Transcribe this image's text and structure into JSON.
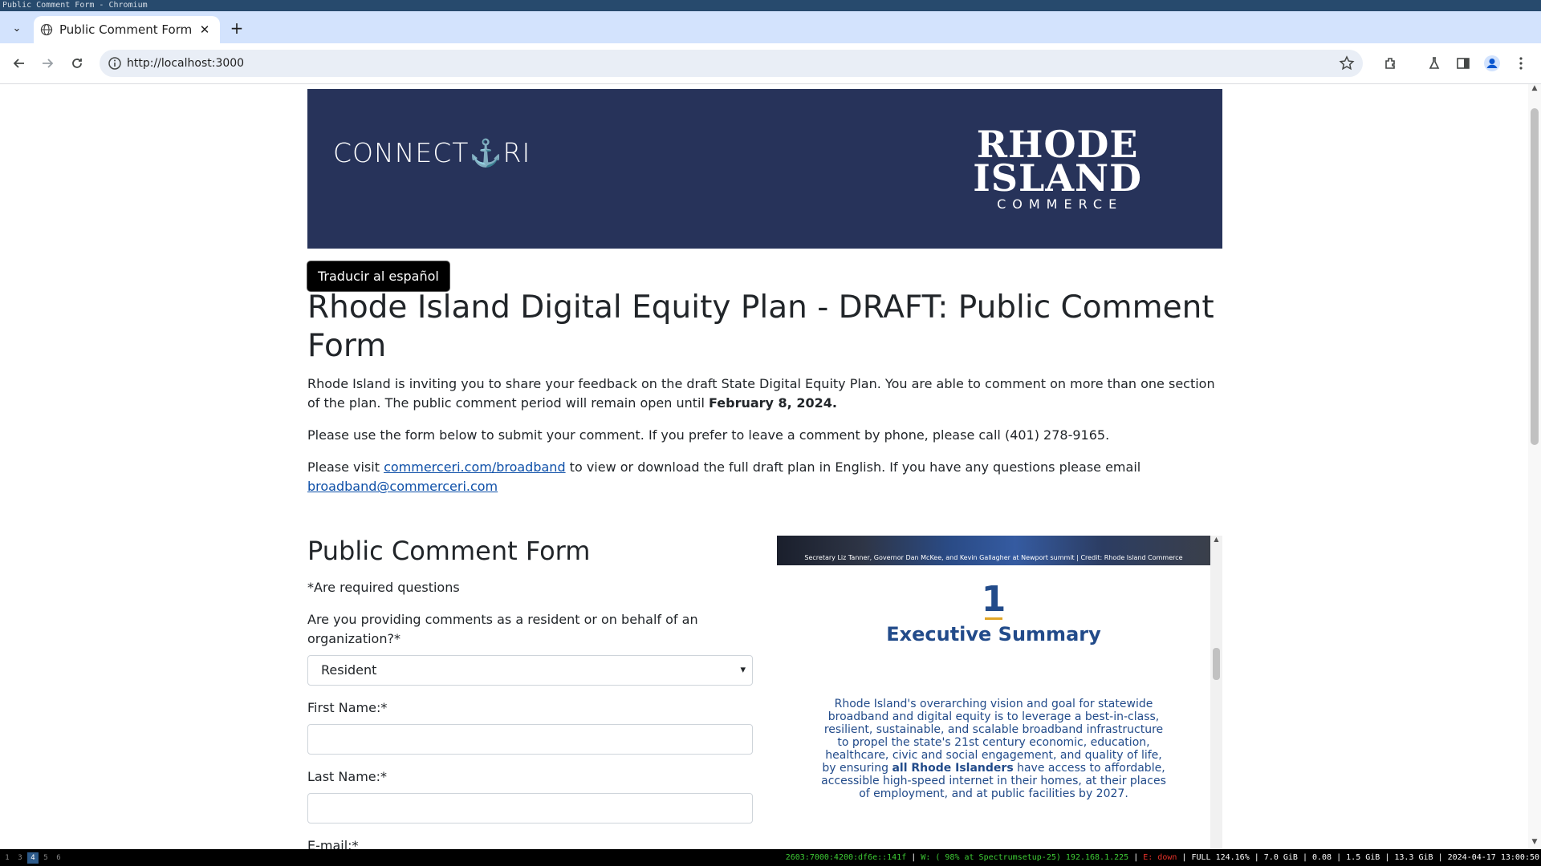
{
  "os": {
    "window_title": "Public Comment Form - Chromium"
  },
  "browser": {
    "tab_title": "Public Comment Form",
    "url": "http://localhost:3000"
  },
  "banner": {
    "connect_logo": "CONNECT⚓RI",
    "ri_logo_line1": "RHODE",
    "ri_logo_line2": "ISLAND",
    "ri_logo_line3": "COMMERCE",
    "background_color": "#27335a"
  },
  "translate_button": "Traducir al español",
  "page_title": "Rhode Island Digital Equity Plan - DRAFT: Public Comment Form",
  "intro": {
    "p1_text": "Rhode Island is inviting you to share your feedback on the draft State Digital Equity Plan. You are able to comment on more than one section of the plan. The public comment period will remain open until ",
    "p1_bold": "February 8, 2024.",
    "p2": "Please use the form below to submit your comment. If you prefer to leave a comment by phone, please call (401) 278-9165.",
    "p3_pre": "Please visit ",
    "p3_link": "commerceri.com/broadband",
    "p3_mid": " to view or download the full draft plan in English. If you have any questions please email ",
    "p3_email": "broadband@commerceri.com"
  },
  "form": {
    "heading": "Public Comment Form",
    "required_note": "*Are required questions",
    "q_type_label": "Are you providing comments as a resident or on behalf of an organization?*",
    "q_type_value": "Resident",
    "first_name_label": "First Name:*",
    "first_name_value": "",
    "last_name_label": "Last Name:*",
    "last_name_value": "",
    "email_label": "E-mail:*"
  },
  "pdf_preview": {
    "photo_caption": "Secretary Liz Tanner, Governor Dan McKee, and Kevin Gallagher at Newport summit | Credit: Rhode Island Commerce",
    "section_number": "1",
    "section_title": "Executive Summary",
    "body_pre": "Rhode Island's overarching vision and goal for statewide broadband and digital equity is to leverage a best-in-class, resilient, sustainable, and scalable broadband infrastructure to propel the state's 21st century economic, education, healthcare, civic and social engagement, and quality of life, by ensuring ",
    "body_bold": "all Rhode Islanders",
    "body_post": " have access to affordable, accessible high-speed internet in their homes, at their places of employment, and at public facilities by 2027.",
    "accent_color": "#224b8a",
    "underline_color": "#e0a526"
  },
  "statusbar": {
    "workspaces": [
      "1",
      "3",
      "4",
      "5",
      "6"
    ],
    "active_workspace": "4",
    "ipv6": "2603:7000:4200:df6e::141f",
    "wifi": "W: ( 98% at Spectrumsetup-25) 192.168.1.225",
    "ethernet": "E: down",
    "battery": "FULL 124.16%",
    "mem": "7.0 GiB",
    "load": "0.08",
    "swap": "1.5 GiB",
    "disk": "13.3 GiB",
    "datetime": "2024-04-17 13:00:50"
  }
}
